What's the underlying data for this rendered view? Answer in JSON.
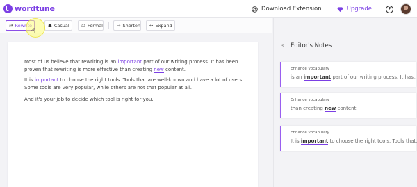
{
  "header": {
    "logo_text": "wordtune",
    "download_label": "Download Extension",
    "upgrade_label": "Upgrade",
    "help_label": "?"
  },
  "toolbar": {
    "rewrite": "Rewrite",
    "casual": "Casual",
    "formal": "Formal",
    "shorten": "Shorten",
    "expand": "Expand",
    "icons": {
      "rewrite": "⇄",
      "casual": "☗",
      "formal": "☖",
      "shorten": "↦",
      "expand": "↔"
    }
  },
  "editor": {
    "p1_a": "Most of us believe that rewriting is an ",
    "p1_hl": "important",
    "p1_b": " part of our writing process. It has been proven that rewriting is more effective than creating ",
    "p1_hl2": "new",
    "p1_c": " content.",
    "p2_a": "It is ",
    "p2_hl": "important",
    "p2_b": " to choose the right tools. Tools that are well-known and have a lot of users. Some tools are very popular, while others are not that popular at all.",
    "p3": "And it's your job to decide which tool is right for you."
  },
  "notes": {
    "count": "3",
    "title": "Editor's Notes",
    "cards": [
      {
        "label": "Enhance vocabulary",
        "pre": "is an ",
        "word": "important",
        "post": " part of our writing process. It has..."
      },
      {
        "label": "Enhance vocabulary",
        "pre": "than creating ",
        "word": "new",
        "post": " content."
      },
      {
        "label": "Enhance vocabulary",
        "pre": "It is ",
        "word": "important",
        "post": " to choose the right tools. Tools that..."
      }
    ]
  },
  "colors": {
    "accent": "#7b3fe4",
    "panel_bg": "#f3f3f6"
  }
}
